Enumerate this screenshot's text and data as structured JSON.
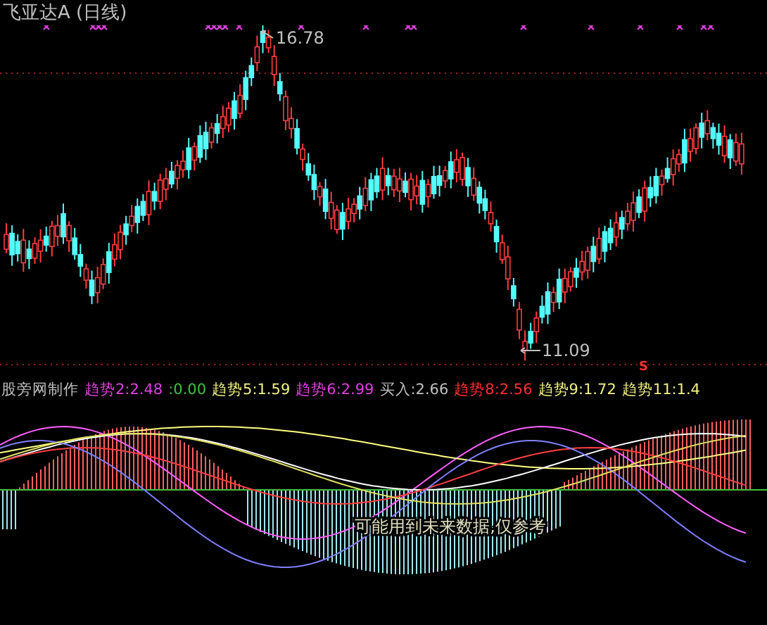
{
  "title": "飞亚达A (日线)",
  "main_chart": {
    "high_label": "16.78",
    "low_label": "11.09",
    "signal": "S"
  },
  "legend": [
    {
      "text": "股旁网制作",
      "color": "#c0c0c0"
    },
    {
      "text": "趋势2:2.48",
      "color": "#e040e0"
    },
    {
      "text": ":0.00",
      "color": "#40c040"
    },
    {
      "text": "趋势5:1.59",
      "color": "#f0f080"
    },
    {
      "text": "趋势6:2.99",
      "color": "#e040e0"
    },
    {
      "text": "买入:2.66",
      "color": "#c0c0c0"
    },
    {
      "text": "趋势8:2.56",
      "color": "#ff3030"
    },
    {
      "text": "趋势9:1.72",
      "color": "#f0f080"
    },
    {
      "text": "趋势11:1.4",
      "color": "#f0f080"
    }
  ],
  "indicator": {
    "note": "可能用到未来数据,仅参考"
  }
}
